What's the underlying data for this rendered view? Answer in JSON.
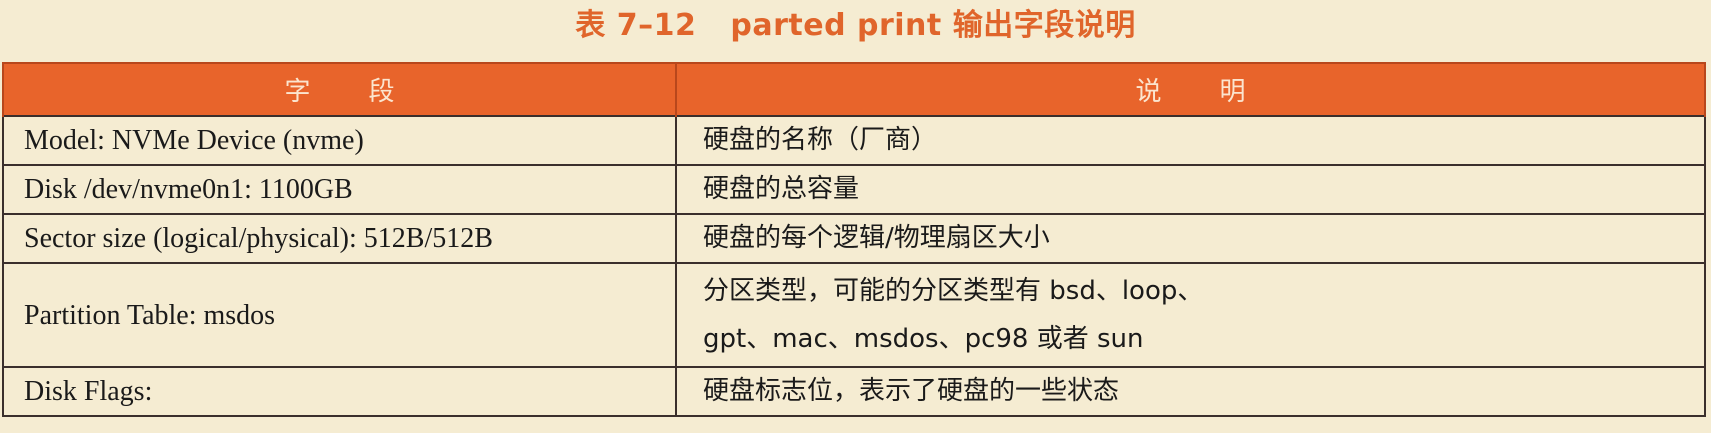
{
  "caption": {
    "number": "表 7–12",
    "title": "parted print 输出字段说明"
  },
  "table": {
    "headers": [
      "字段",
      "说明"
    ],
    "rows": [
      {
        "field": "Model: NVMe Device (nvme)",
        "desc_lines": [
          "硬盘的名称（厂商）"
        ]
      },
      {
        "field": "Disk /dev/nvme0n1: 1100GB",
        "desc_lines": [
          "硬盘的总容量"
        ]
      },
      {
        "field": "Sector size (logical/physical): 512B/512B",
        "desc_lines": [
          "硬盘的每个逻辑/物理扇区大小"
        ]
      },
      {
        "field": "Partition Table: msdos",
        "desc_lines": [
          "分区类型，可能的分区类型有 bsd、loop、",
          "gpt、mac、msdos、pc98 或者 sun"
        ]
      },
      {
        "field": "Disk Flags:",
        "desc_lines": [
          "硬盘标志位，表示了硬盘的一些状态"
        ]
      }
    ]
  }
}
